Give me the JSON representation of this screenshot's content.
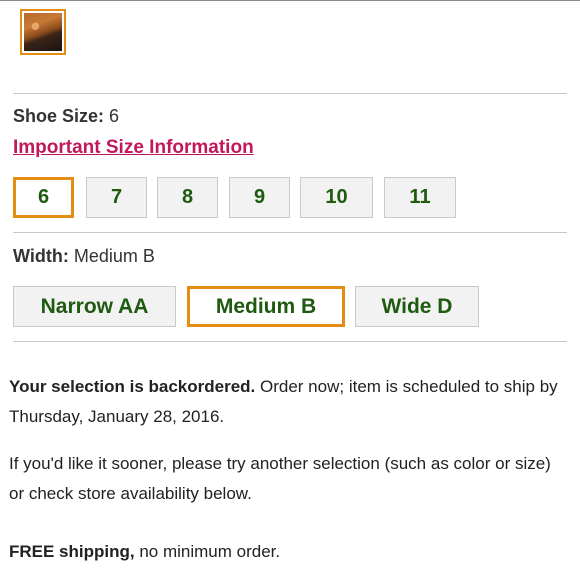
{
  "shoe_size": {
    "label": "Shoe Size:",
    "selected_value": "6",
    "size_info_link": "Important Size Information",
    "options": [
      "6",
      "7",
      "8",
      "9",
      "10",
      "11"
    ],
    "selected_index": 0
  },
  "width": {
    "label": "Width:",
    "selected_value": "Medium B",
    "options": [
      "Narrow AA",
      "Medium B",
      "Wide D"
    ],
    "selected_index": 1
  },
  "availability": {
    "backorder_bold": "Your selection is backordered.",
    "backorder_text": " Order now; item is scheduled to ship by Thursday, January 28, 2016.",
    "sooner_text": "If you'd like it sooner, please try another selection (such as color or size) or check store availability below.",
    "shipping_bold": "FREE shipping,",
    "shipping_text": " no minimum order."
  },
  "colors": {
    "accent_orange": "#e38d13",
    "option_text_green": "#1e5a0f",
    "link_pink": "#c2185b"
  }
}
